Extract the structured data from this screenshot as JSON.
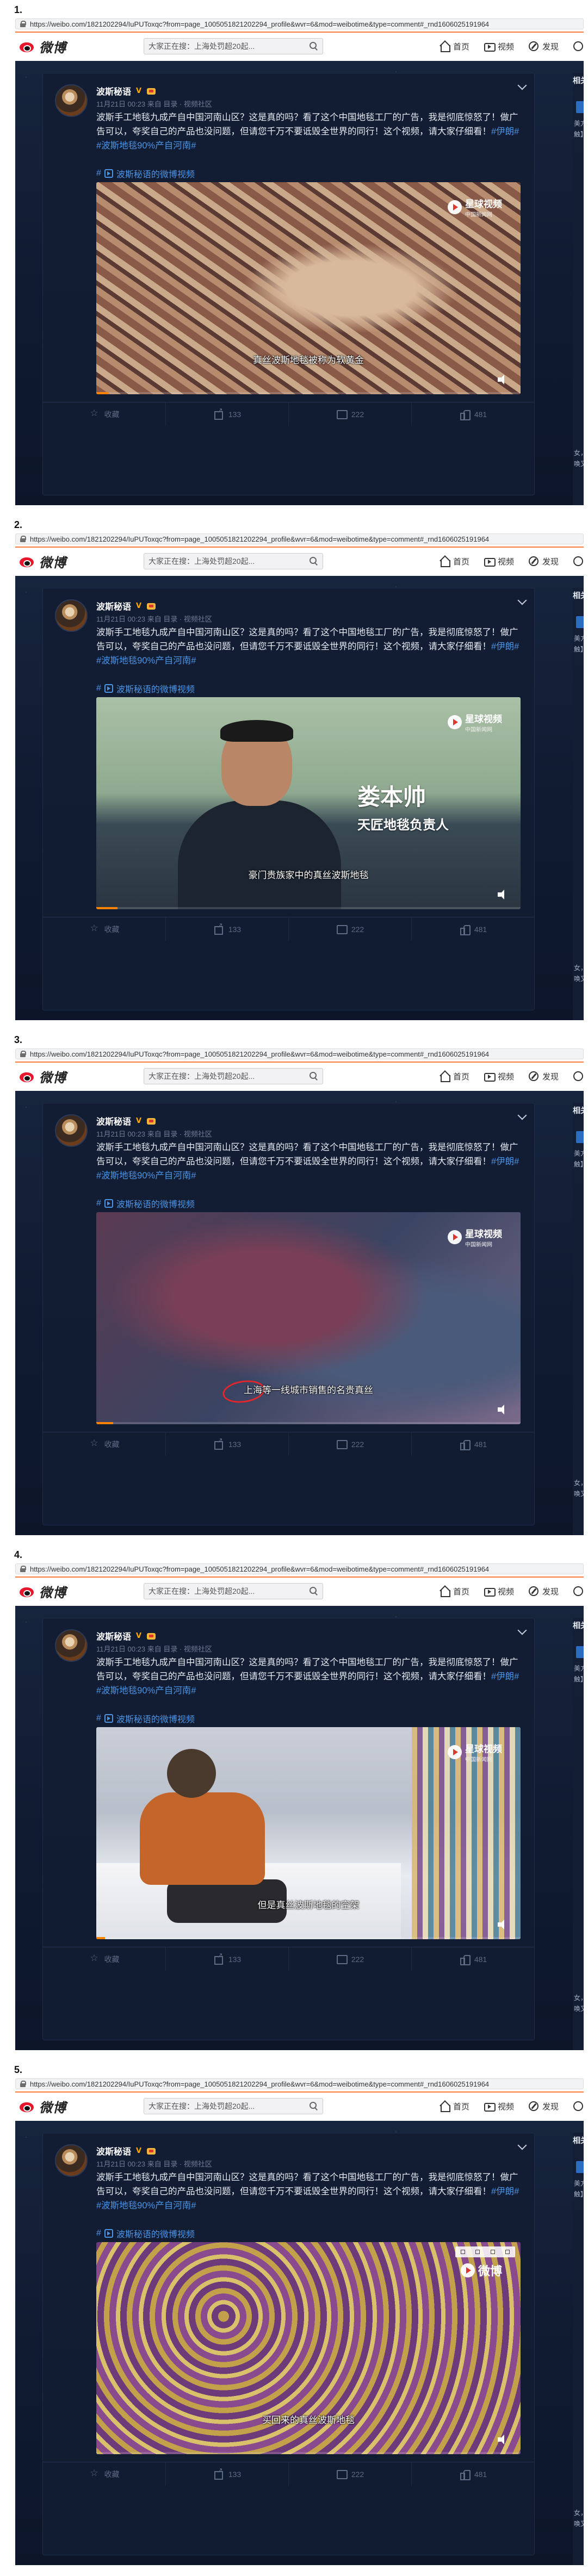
{
  "browser": {
    "url": "https://weibo.com/1821202294/IuPUToxqc?from=page_1005051821202294_profile&wvr=6&mod=weibotime&type=comment#_rnd1606025191964"
  },
  "header": {
    "logo_text": "微博",
    "search_placeholder": "大家正在搜：上海处罚超20起...",
    "nav": [
      {
        "label": "首页",
        "icon": "home-icon"
      },
      {
        "label": "视频",
        "icon": "video-icon"
      },
      {
        "label": "发现",
        "icon": "discover-icon"
      }
    ]
  },
  "post": {
    "author": "波斯秘语",
    "verified_mark": "V",
    "meta": "11月21日 00:23 来自 目录 · 视频社区",
    "text_plain": "波斯手工地毯九成产自中国河南山区？这是真的吗？看了这个中国地毯工厂的广告，我是彻底惊怒了！做广告可以，夸奖自己的产品也没问题，但请您千万不要诋毁全世界的同行！这个视频，请大家仔细看！",
    "hashtags": "#伊朗# #波斯地毯90%产自河南#",
    "link_hash": "#",
    "link_label": "波斯秘语的微博视频",
    "actions": {
      "favorite": "收藏",
      "share": "133",
      "comment": "222",
      "like": "481"
    }
  },
  "right_strip": {
    "header": "相关",
    "snippet_a": "美方",
    "snippet_b": "触】",
    "snippet_c": "女，",
    "snippet_d": "唤又"
  },
  "panels": [
    {
      "number": "1.",
      "subtitle": "真丝波斯地毯被称为软黄金",
      "watermark_main": "星球视频",
      "watermark_sub": "中国新闻网",
      "progress": 0.03
    },
    {
      "number": "2.",
      "subtitle": "豪门贵族家中的真丝波斯地毯",
      "watermark_main": "星球视频",
      "watermark_sub": "中国新闻网",
      "name_title": "娄本帅",
      "name_role": "天匠地毯负责人",
      "progress": 0.05
    },
    {
      "number": "3.",
      "subtitle": "上海等一线城市销售的名贵真丝",
      "watermark_main": "星球视频",
      "watermark_sub": "中国新闻网",
      "progress": 0.04
    },
    {
      "number": "4.",
      "subtitle": "但是真丝波斯地毯的空架",
      "watermark_main": "星球视频",
      "watermark_sub": "中国新闻网",
      "progress": 0.02
    },
    {
      "number": "5.",
      "subtitle": "买回来的真丝波斯地毯",
      "watermark_main": "微博",
      "watermark_sub": "",
      "progress": 0.0
    }
  ]
}
